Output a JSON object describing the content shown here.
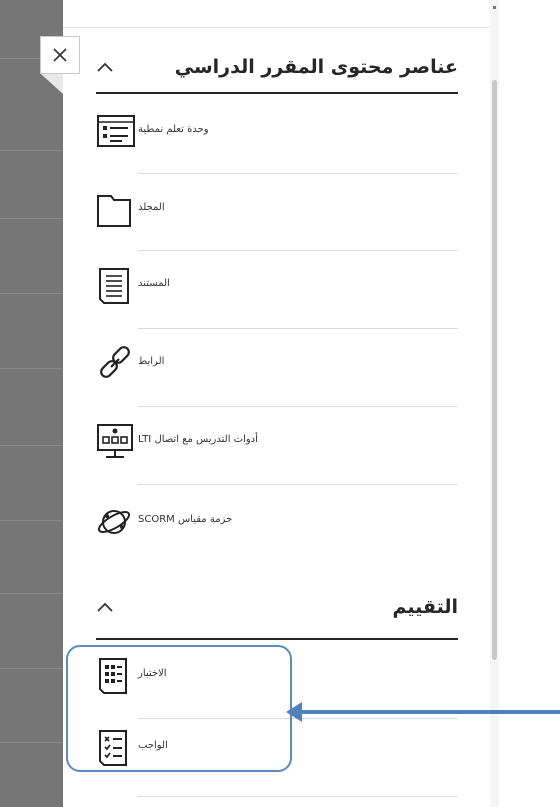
{
  "sections": [
    {
      "title": "عناصر محتوى المقرر الدراسي",
      "items": [
        {
          "label": "وحدة تعلم نمطية",
          "icon": "learning-module-icon"
        },
        {
          "label": "المجلد",
          "icon": "folder-icon"
        },
        {
          "label": "المستند",
          "icon": "document-icon"
        },
        {
          "label": "الرابط",
          "icon": "link-icon"
        },
        {
          "label": "LTI أدوات التدريس مع اتصال",
          "icon": "lti-tool-icon"
        },
        {
          "label": "SCORM حزمة مقياس",
          "icon": "scorm-package-icon"
        }
      ]
    },
    {
      "title": "التقييم",
      "items": [
        {
          "label": "الاختبار",
          "icon": "test-icon"
        },
        {
          "label": "الواجب",
          "icon": "assignment-icon"
        }
      ]
    }
  ],
  "close_label": "×",
  "colors": {
    "highlight": "#5a8bc2",
    "arrow": "#4f81bd",
    "background_strip": "#767676"
  }
}
